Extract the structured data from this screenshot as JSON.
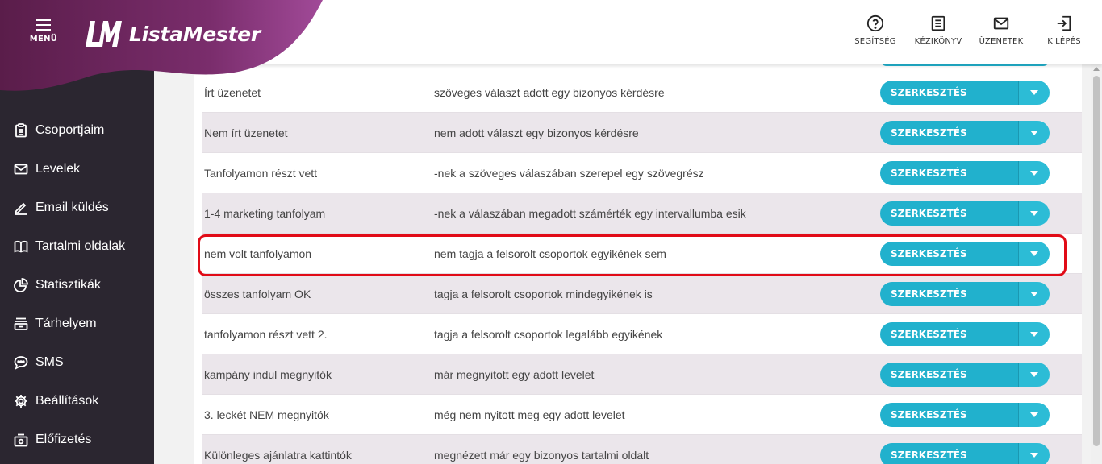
{
  "header": {
    "menu_label": "MENÜ",
    "logo_text": "ListaMester",
    "actions": [
      {
        "label": "SEGÍTSÉG",
        "icon": "help-circle-icon"
      },
      {
        "label": "KÉZIKÖNYV",
        "icon": "manual-icon"
      },
      {
        "label": "ÜZENETEK",
        "icon": "mail-icon"
      },
      {
        "label": "KILÉPÉS",
        "icon": "logout-icon"
      }
    ]
  },
  "sidebar": {
    "items": [
      {
        "label": "Csoportjaim",
        "icon": "clipboard-icon"
      },
      {
        "label": "Levelek",
        "icon": "envelope-icon"
      },
      {
        "label": "Email küldés",
        "icon": "pencil-icon"
      },
      {
        "label": "Tartalmi oldalak",
        "icon": "book-icon"
      },
      {
        "label": "Statisztikák",
        "icon": "pie-chart-icon"
      },
      {
        "label": "Tárhelyem",
        "icon": "storage-icon"
      },
      {
        "label": "SMS",
        "icon": "chat-icon"
      },
      {
        "label": "Beállítások",
        "icon": "gear-icon"
      },
      {
        "label": "Előfizetés",
        "icon": "subscription-icon"
      }
    ]
  },
  "table": {
    "edit_label": "SZERKESZTÉS",
    "rows": [
      {
        "name": "Írt üzenetet",
        "desc": "szöveges választ adott egy bizonyos kérdésre"
      },
      {
        "name": "Nem írt üzenetet",
        "desc": "nem adott választ egy bizonyos kérdésre"
      },
      {
        "name": "Tanfolyamon részt vett",
        "desc": "-nek a szöveges válaszában szerepel egy szövegrész"
      },
      {
        "name": "1-4 marketing tanfolyam",
        "desc": "-nek a válaszában megadott számérték egy intervallumba esik"
      },
      {
        "name": "nem volt tanfolyamon",
        "desc": "nem tagja a felsorolt csoportok egyikének sem"
      },
      {
        "name": "összes tanfolyam OK",
        "desc": "tagja a felsorolt csoportok mindegyikének is"
      },
      {
        "name": "tanfolyamon részt vett 2.",
        "desc": "tagja a felsorolt csoportok legalább egyikének"
      },
      {
        "name": "kampány indul megnyitók",
        "desc": "már megnyitott egy adott levelet"
      },
      {
        "name": "3. leckét NEM megnyitók",
        "desc": "még nem nyitott meg egy adott levelet"
      },
      {
        "name": "Különleges ajánlatra kattintók",
        "desc": "megnézett már egy bizonyos tartalmi oldalt"
      }
    ]
  },
  "colors": {
    "brand_gradient_start": "#5e1f4d",
    "brand_gradient_end": "#9a3f92",
    "sidebar_bg": "#2b2630",
    "button": "#21b1cd",
    "highlight": "#e10b17"
  }
}
